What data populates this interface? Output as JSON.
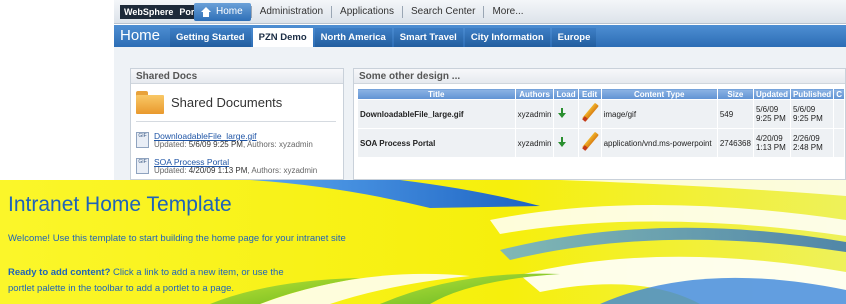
{
  "portal": {
    "logo": "WebSphere",
    "logo_suffix": "Portal",
    "top_nav": {
      "home": "Home",
      "links": [
        "Administration",
        "Applications",
        "Search Center",
        "More..."
      ]
    },
    "page_label": "Home",
    "sub_tabs": [
      "Getting Started",
      "PZN Demo",
      "North America",
      "Smart Travel",
      "City Information",
      "Europe"
    ],
    "active_sub_tab": "PZN Demo"
  },
  "shared_docs": {
    "portlet_title": "Shared Docs",
    "heading": "Shared Documents",
    "items": [
      {
        "icon": "gif",
        "name": "DownloadableFile_large.gif",
        "meta_prefix": "Updated: ",
        "meta_date": "5/6/09 9:25 PM",
        "meta_authors": ", Authors: xyzadmin"
      },
      {
        "icon": "gif",
        "name": "SOA Process Portal",
        "meta_prefix": "Updated: ",
        "meta_date": "4/20/09 1:13 PM",
        "meta_authors": ", Authors: xyzadmin"
      }
    ]
  },
  "design_table": {
    "portlet_title": "Some other design ...",
    "columns": [
      "Title",
      "Authors",
      "Load",
      "Edit",
      "Content Type",
      "Size",
      "Updated",
      "Published",
      "C"
    ],
    "rows": [
      {
        "title": "DownloadableFile_large.gif",
        "authors": "xyzadmin",
        "content_type": "image/gif",
        "size": "549",
        "updated": "5/6/09\n9:25 PM",
        "published": "5/6/09\n9:25 PM"
      },
      {
        "title": "SOA Process Portal",
        "authors": "xyzadmin",
        "content_type": "application/vnd.ms-powerpoint",
        "size": "2746368",
        "updated": "4/20/09\n1:13 PM",
        "published": "2/26/09\n2:48 PM"
      }
    ]
  },
  "banner": {
    "title": "Intranet Home Template",
    "welcome": "Welcome! Use this template to start building the home page for your intranet site",
    "ready_bold": "Ready to add content?",
    "ready_text": " Click a link to add a new item, or use the portlet palette in the toolbar to add a portlet to a page.",
    "colors": {
      "text": "#1e63b9",
      "yellow": "#f7f20a",
      "green": "#8ccc2a",
      "blue": "#2b7fd8"
    }
  }
}
